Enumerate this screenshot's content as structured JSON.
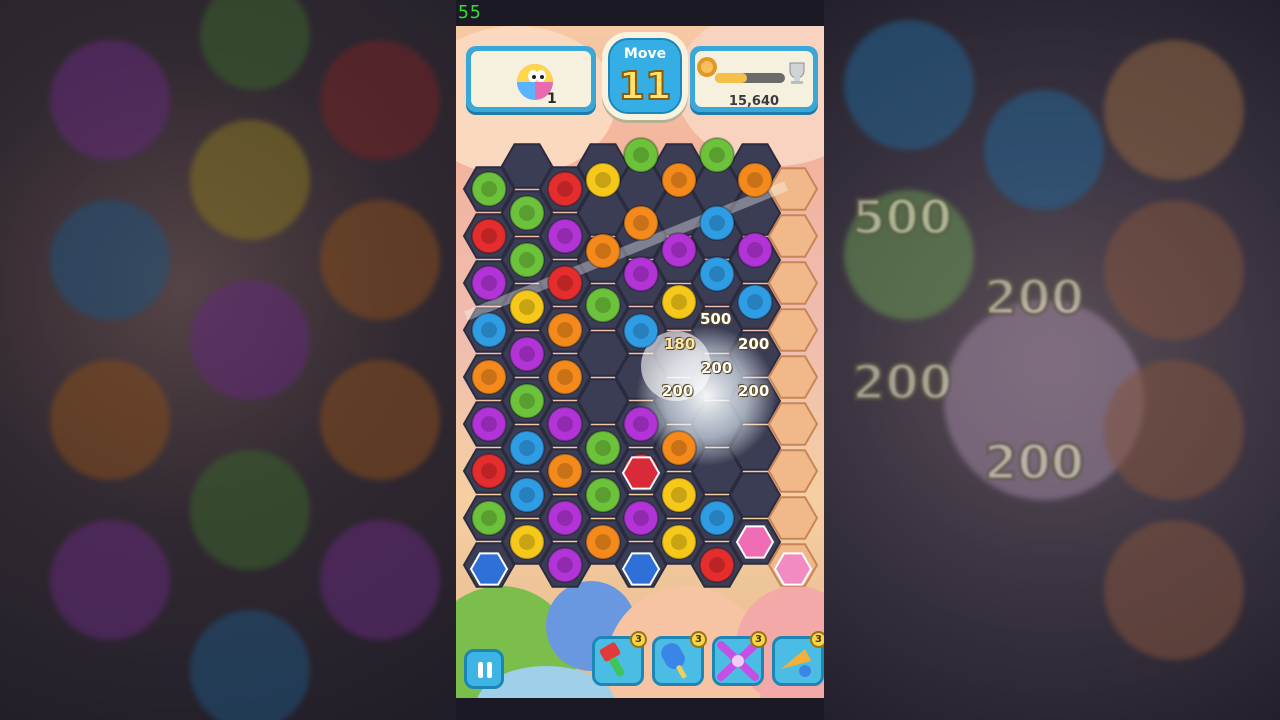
{
  "debug": {
    "fps": "55"
  },
  "hud": {
    "goal_count": "1",
    "move_label": "Move",
    "moves_left": "11",
    "score": "15,640",
    "score_progress": 0.45,
    "goal_icon": "rainbow-bird-icon",
    "trophy_icon": "trophy-icon",
    "lion_icon": "lion-icon"
  },
  "floating_points": [
    "500",
    "180",
    "200",
    "200",
    "200",
    "200"
  ],
  "side_points": [
    "500",
    "200",
    "200",
    "200"
  ],
  "boosters": [
    {
      "name": "hammer-booster",
      "count": "3"
    },
    {
      "name": "popsicle-booster",
      "count": "3"
    },
    {
      "name": "ribbon-booster",
      "count": "3"
    },
    {
      "name": "horn-booster",
      "count": "3"
    }
  ],
  "colors": {
    "green": "#6cc23a",
    "red": "#e52d2e",
    "yellow": "#f5c819",
    "orange": "#f48a1c",
    "blue": "#2f9de4",
    "purple": "#b234d6",
    "hud_blue": "#3aa7d9"
  }
}
